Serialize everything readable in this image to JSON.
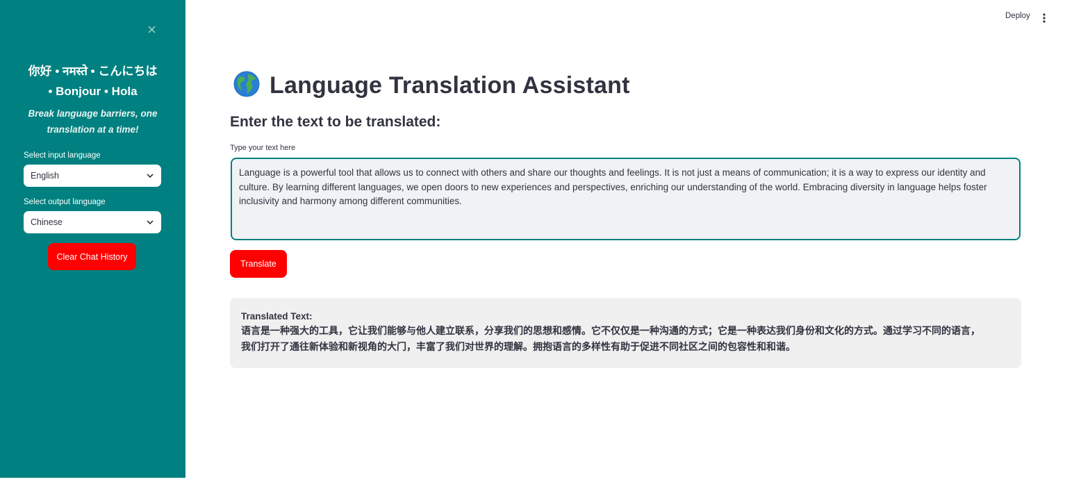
{
  "header": {
    "deploy_label": "Deploy",
    "menu_icon": "vertical-ellipsis-icon"
  },
  "sidebar": {
    "close_icon": "close-icon",
    "greeting_line1": "你好 • नमस्ते • こんにちは",
    "greeting_line2": "• Bonjour • Hola",
    "tagline": "Break language barriers, one translation at a time!",
    "input_language_label": "Select input language",
    "input_language_value": "English",
    "output_language_label": "Select output language",
    "output_language_value": "Chinese",
    "clear_button_label": "Clear Chat History",
    "background_color": "#008080"
  },
  "main": {
    "title_icon": "globe-icon",
    "title": "Language Translation Assistant",
    "subheading": "Enter the text to be translated:",
    "textarea_label": "Type your text here",
    "textarea_value": "Language is a powerful tool that allows us to connect with others and share our thoughts and feelings. It is not just a means of communication; it is a way to express our identity and culture. By learning different languages, we open doors to new experiences and perspectives, enriching our understanding of the world. Embracing diversity in language helps foster inclusivity and harmony among different communities.",
    "translate_button_label": "Translate",
    "result_label": "Translated Text:",
    "result_text_line1": "语言是一种强大的工具，它让我们能够与他人建立联系，分享我们的思想和感情。它不仅仅是一种沟通的方式；它是一种表达我们身份和文化的方式。通过学习不同的语言，",
    "result_text_line2": "我们打开了通往新体验和新视角的大门，丰富了我们对世界的理解。拥抱语言的多样性有助于促进不同社区之间的包容性和和谐。",
    "accent_color": "#ff0000"
  }
}
